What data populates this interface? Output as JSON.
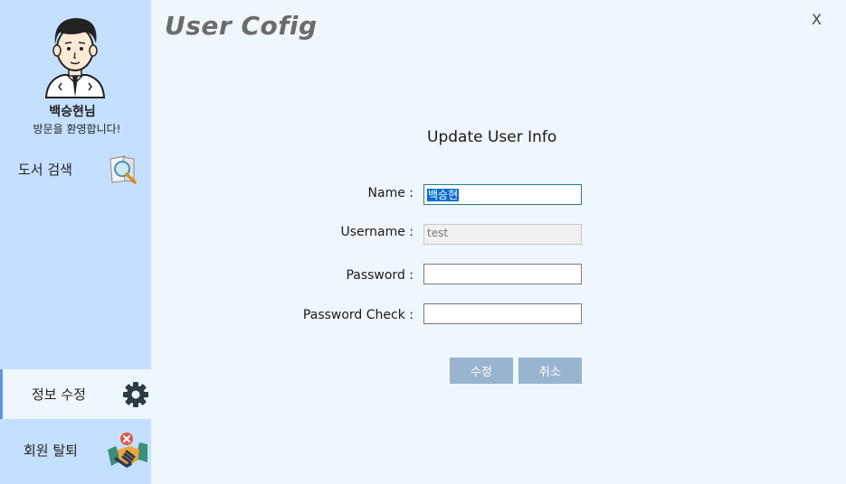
{
  "sidebar": {
    "user_name": "백승현님",
    "welcome": "방문을 환영합니다!",
    "nav": {
      "search": "도서 검색",
      "edit_info": "정보 수정",
      "withdraw": "회원 탈퇴"
    }
  },
  "header": {
    "title": "User Cofig",
    "close": "X"
  },
  "form": {
    "title": "Update User Info",
    "name_label": "Name :",
    "name_value": "백승현",
    "username_label": "Username :",
    "username_value": "test",
    "password_label": "Password :",
    "password_value": "",
    "password_check_label": "Password Check :",
    "password_check_value": "",
    "edit_button": "수정",
    "cancel_button": "취소"
  },
  "icons": {
    "search": "magnifier-book-icon",
    "settings": "gear-icon",
    "withdraw": "handshake-remove-icon"
  },
  "colors": {
    "sidebar_bg": "#c4e0fe",
    "main_bg": "#eef6fe",
    "button_bg": "#99b4cf",
    "active_accent": "#5a97e0"
  }
}
